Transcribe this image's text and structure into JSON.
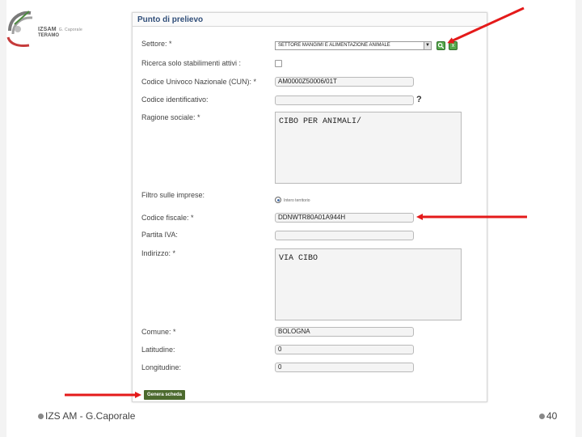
{
  "logo": {
    "line1": "IZSAM",
    "line1_small": "G. Caporale",
    "line2": "TERAMO"
  },
  "panel": {
    "title": "Punto di prelievo"
  },
  "form": {
    "settore": {
      "label": "Settore: *",
      "value": "SETTORE MANGIMI E ALIMENTAZIONE ANIMALE",
      "arrow": "▼",
      "search_icon": "🔍",
      "clear_icon": "x"
    },
    "ricerca": {
      "label": "Ricerca solo stabilimenti attivi :",
      "checked": false
    },
    "cun": {
      "label": "Codice Univoco Nazionale (CUN): *",
      "value": "AM0000Z50006/01T"
    },
    "codice_identificativo": {
      "label": "Codice identificativo:",
      "value": "",
      "help": "?"
    },
    "ragione_sociale": {
      "label": "Ragione sociale: *",
      "value": "CIBO PER ANIMALI/"
    },
    "filtro": {
      "label": "Filtro sulle imprese:",
      "option": "Intero territorio"
    },
    "codice_fiscale": {
      "label": "Codice fiscale: *",
      "value": "DDNWTR80A01A944H"
    },
    "partita_iva": {
      "label": "Partita IVA:",
      "value": ""
    },
    "indirizzo": {
      "label": "Indirizzo: *",
      "value": "VIA CIBO"
    },
    "comune": {
      "label": "Comune: *",
      "value": "BOLOGNA"
    },
    "latitudine": {
      "label": "Latitudine:",
      "value": "0"
    },
    "longitudine": {
      "label": "Longitudine:",
      "value": "0"
    },
    "genera_button": "Genera scheda"
  },
  "footer": {
    "left": "IZS AM  -  G.Caporale",
    "page": "40"
  },
  "colors": {
    "arrow": "#e41a1a",
    "title": "#314f7a",
    "button": "#4c6a2e"
  }
}
